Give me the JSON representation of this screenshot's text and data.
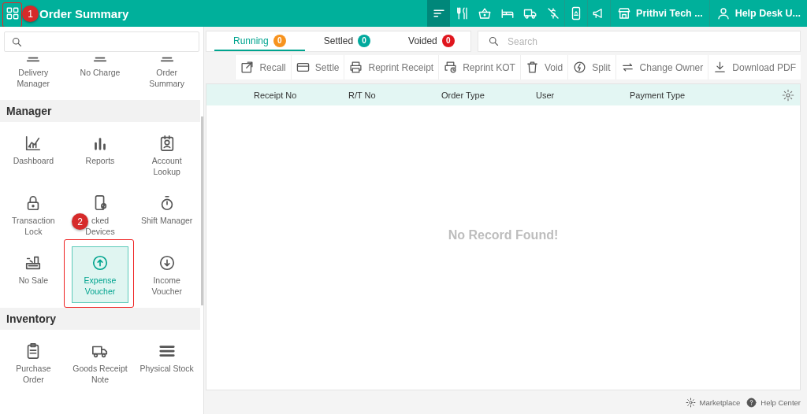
{
  "top_bar": {
    "title": "Order Summary",
    "nav_icons": [
      {
        "selected": true
      },
      {
        "selected": false
      },
      {
        "selected": false
      },
      {
        "selected": false
      },
      {
        "selected": false
      },
      {
        "selected": false
      },
      {
        "selected": false
      },
      {
        "selected": false
      }
    ],
    "store": "Prithvi Tech ...",
    "user": "Help Desk U..."
  },
  "sidebar": {
    "sections": [
      {
        "items": [
          {
            "label": "Delivery Manager",
            "selected": false
          },
          {
            "label": "No Charge",
            "selected": false
          },
          {
            "label": "Order Summary",
            "selected": false
          }
        ]
      },
      {
        "title": "Manager",
        "items": [
          {
            "label": "Dashboard",
            "selected": false
          },
          {
            "label": "Reports",
            "selected": false
          },
          {
            "label": "Account Lookup",
            "selected": false
          },
          {
            "label": "Transaction Lock",
            "selected": false
          },
          {
            "label": "cked\nDevices",
            "selected": false
          },
          {
            "label": "Shift Manager",
            "selected": false
          },
          {
            "label": "No Sale",
            "selected": false
          },
          {
            "label": "Expense Voucher",
            "selected": true
          },
          {
            "label": "Income Voucher",
            "selected": false
          }
        ]
      },
      {
        "title": "Inventory",
        "items": [
          {
            "label": "Purchase Order",
            "selected": false
          },
          {
            "label": "Goods Receipt Note",
            "selected": false
          },
          {
            "label": "Physical Stock",
            "selected": false
          }
        ]
      }
    ]
  },
  "tabs": [
    {
      "label": "Running",
      "count": "0",
      "color": "#f7931e",
      "selected": true
    },
    {
      "label": "Settled",
      "count": "0",
      "color": "#00a99d",
      "selected": false
    },
    {
      "label": "Voided",
      "count": "0",
      "color": "#e0161e",
      "selected": false
    }
  ],
  "search": {
    "placeholder": "Search"
  },
  "toolbar": [
    "Recall",
    "Settle",
    "Reprint Receipt",
    "Reprint KOT",
    "Void",
    "Split",
    "Change Owner",
    "Download PDF"
  ],
  "table": {
    "columns": [
      "Receipt No",
      "R/T No",
      "Order Type",
      "User",
      "Payment Type"
    ],
    "empty_message": "No Record Found!"
  },
  "footer": [
    "Marketplace",
    "Help Center"
  ],
  "annotations": [
    {
      "label": "1"
    },
    {
      "label": "2"
    }
  ]
}
